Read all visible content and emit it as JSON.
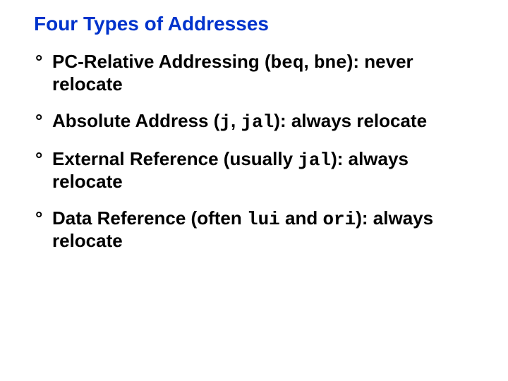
{
  "title": "Four Types of Addresses",
  "bullets": [
    {
      "prefix": "PC-Relative Addressing (",
      "code1": "beq",
      "mid1": ", ",
      "code2": "bne",
      "suffix": "): never relocate"
    },
    {
      "prefix": "Absolute Address (",
      "code1": "j",
      "mid1": ", ",
      "code2": "jal",
      "suffix": "): always relocate"
    },
    {
      "prefix": "External Reference (usually ",
      "code1": "jal",
      "mid1": "",
      "code2": "",
      "suffix": "): always relocate"
    },
    {
      "prefix": "Data Reference (often ",
      "code1": "lui",
      "mid1": " and ",
      "code2": "ori",
      "suffix": "): always relocate"
    }
  ],
  "bullet_marker": "°"
}
